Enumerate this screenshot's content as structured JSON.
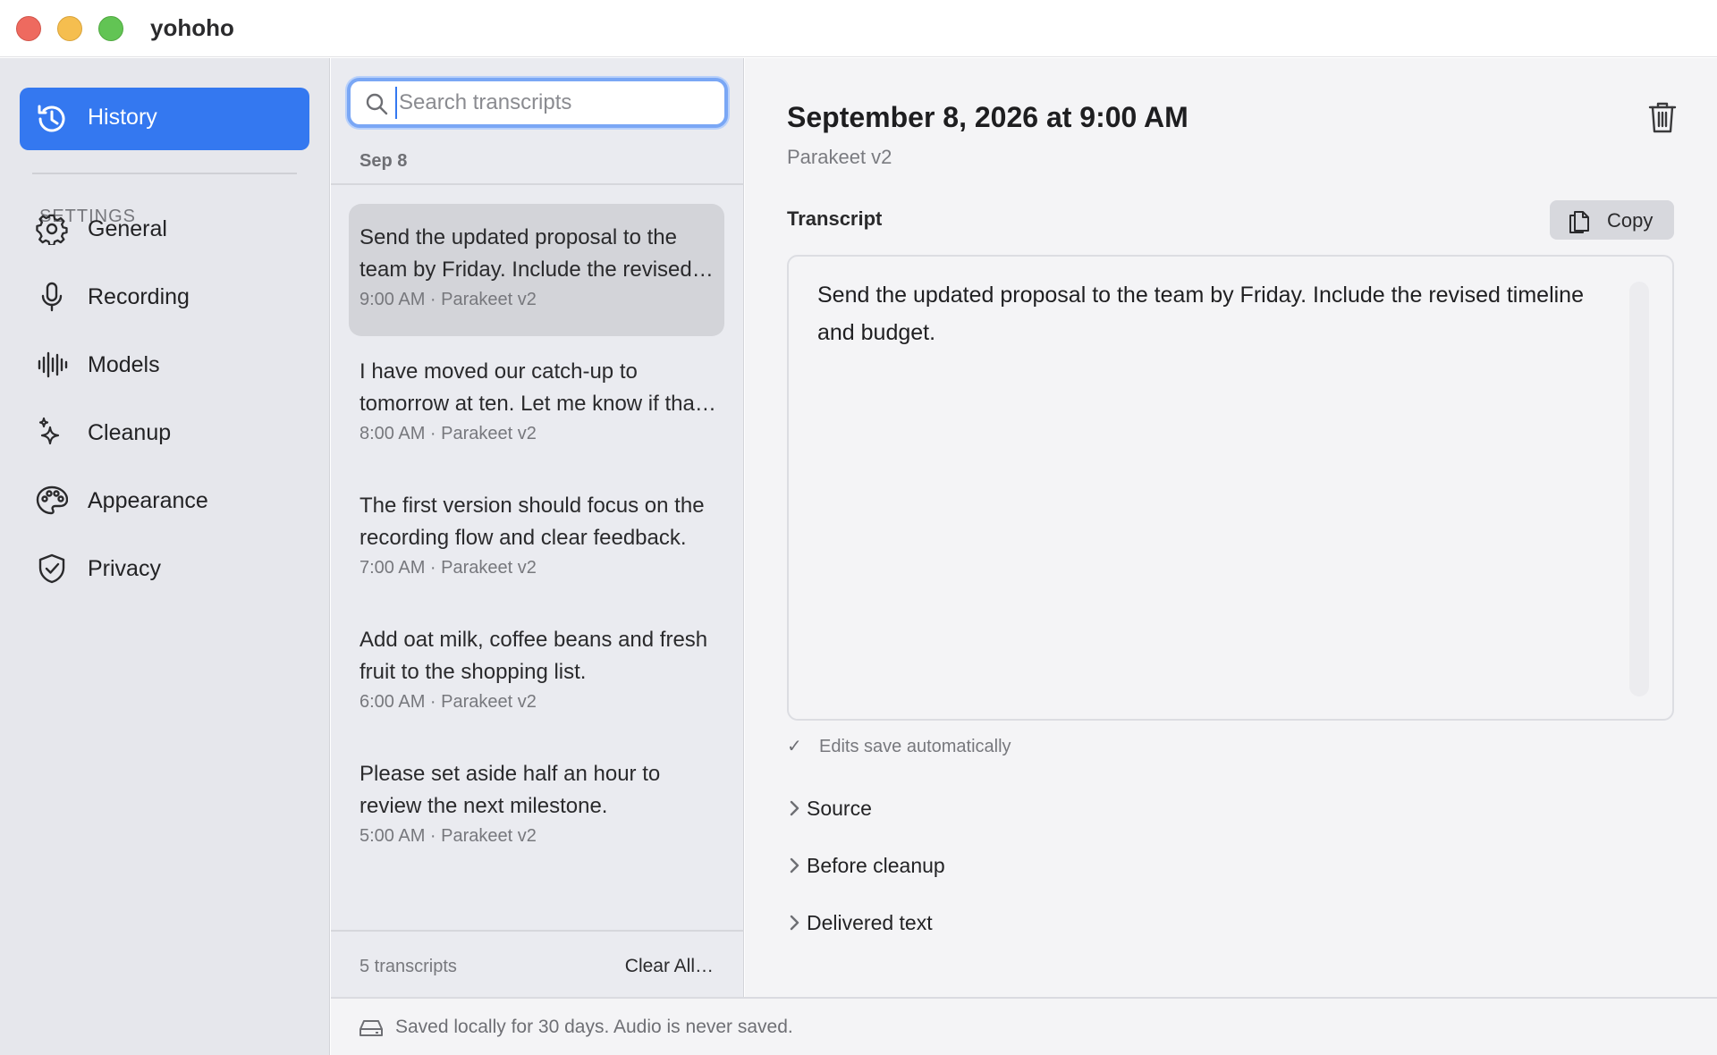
{
  "window": {
    "title": "yohoho"
  },
  "sidebar": {
    "active": {
      "label": "History",
      "icon": "history-icon"
    },
    "section_label": "SETTINGS",
    "items": [
      {
        "label": "General",
        "icon": "gear-icon"
      },
      {
        "label": "Recording",
        "icon": "microphone-icon"
      },
      {
        "label": "Models",
        "icon": "waveform-icon"
      },
      {
        "label": "Cleanup",
        "icon": "sparkles-icon"
      },
      {
        "label": "Appearance",
        "icon": "palette-icon"
      },
      {
        "label": "Privacy",
        "icon": "shield-check-icon"
      }
    ]
  },
  "list": {
    "search": {
      "placeholder": "Search transcripts",
      "value": ""
    },
    "date_header": "Sep 8",
    "items": [
      {
        "text": "Send the updated proposal to the team by Friday. Include the revised timeline and budget.",
        "meta": "9:00 AM · Parakeet v2",
        "selected": true
      },
      {
        "text": "I have moved our catch-up to tomorrow at ten. Let me know if that works.",
        "meta": "8:00 AM · Parakeet v2"
      },
      {
        "text": "The first version should focus on the recording flow and clear feedback.",
        "meta": "7:00 AM · Parakeet v2"
      },
      {
        "text": "Add oat milk, coffee beans and fresh fruit to the shopping list.",
        "meta": "6:00 AM · Parakeet v2"
      },
      {
        "text": "Please set aside half an hour to review the next milestone.",
        "meta": "5:00 AM · Parakeet v2"
      }
    ],
    "count": "5 transcripts",
    "clear_label": "Clear All…"
  },
  "detail": {
    "title": "September 8, 2026 at 9:00 AM",
    "subtitle": "Parakeet v2",
    "section_title": "Transcript",
    "copy_label": "Copy",
    "transcript": "Send the updated proposal to the team by Friday. Include the revised timeline and budget.",
    "saved_note": "Edits save automatically",
    "disclosures": [
      "Source",
      "Before cleanup",
      "Delivered text"
    ]
  },
  "footer": {
    "text": "Saved locally for 30 days. Audio is never saved."
  },
  "colors": {
    "accent": "#3478f0",
    "sidebar_bg": "#e6e7ec",
    "list_bg": "#eaebf0",
    "detail_bg": "#f4f4f6"
  }
}
